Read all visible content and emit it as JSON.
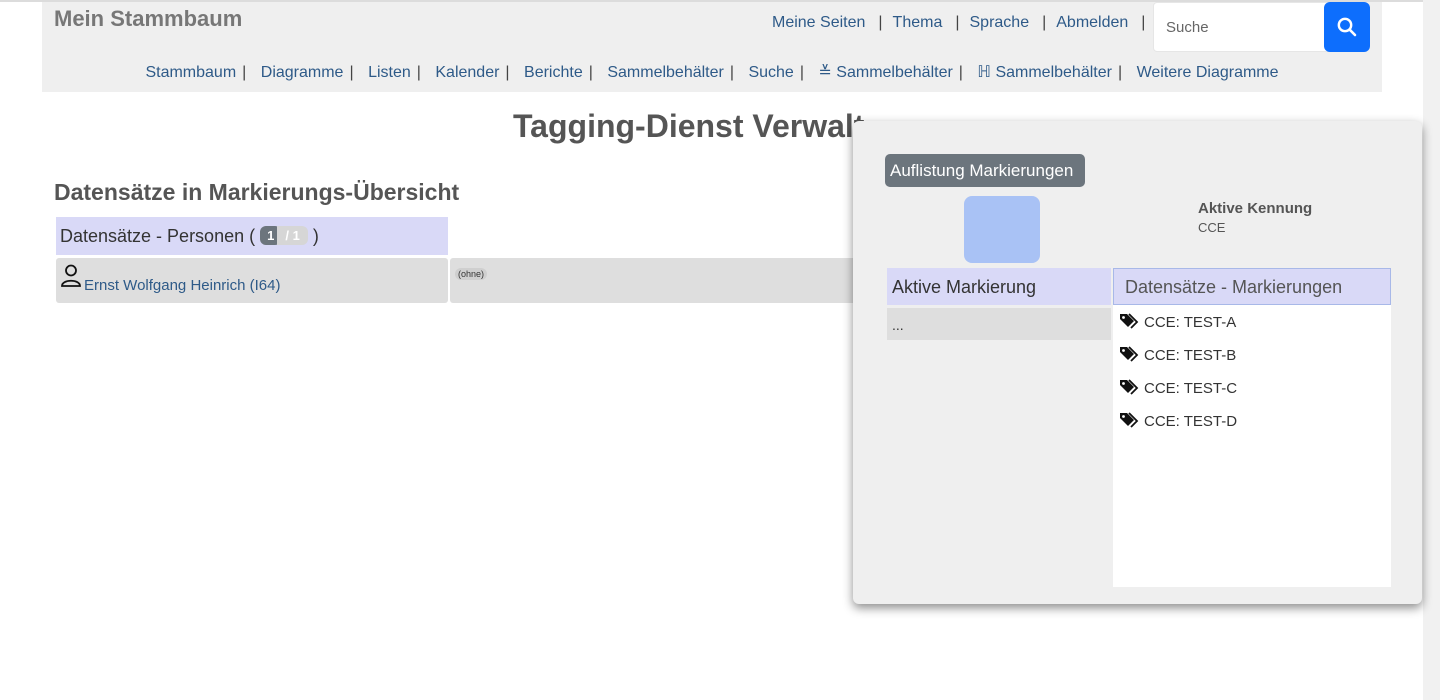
{
  "header": {
    "site_title": "Mein Stammbaum",
    "top_menu": [
      "Meine Seiten",
      "Thema",
      "Sprache",
      "Abmelden"
    ],
    "search_placeholder": "Suche",
    "main_menu": [
      "Stammbaum",
      "Diagramme",
      "Listen",
      "Kalender",
      "Berichte",
      "Sammelbehälter",
      "Suche",
      "≚ Sammelbehälter",
      "ℍ Sammelbehälter",
      "Weitere Diagramme"
    ]
  },
  "page": {
    "title": "Tagging-Dienst Verwalt",
    "section_title": "Datensätze in Markierungs-Übersicht",
    "persons_label_prefix": "Datensätze - Personen (",
    "persons_label_suffix": ")",
    "persons_count": "1",
    "persons_total": "/ 1",
    "person_name": "Ernst Wolfgang Heinrich (I64)",
    "person_tags": "(ohne)"
  },
  "panel": {
    "list_button": "Auflistung Markierungen",
    "active_id_label": "Aktive Kennung",
    "active_id_value": "CCE",
    "active_tag_header": "Aktive Markierung",
    "active_tag_value": "...",
    "records_header": "Datensätze - Markierungen",
    "tags": [
      "CCE: TEST-A",
      "CCE: TEST-B",
      "CCE: TEST-C",
      "CCE: TEST-D"
    ]
  },
  "colors": {
    "accent": "#0d6efd",
    "header_bg": "#efefef",
    "table_head_bg": "#d9d9f7",
    "color_swatch": "#a9c2f5"
  }
}
